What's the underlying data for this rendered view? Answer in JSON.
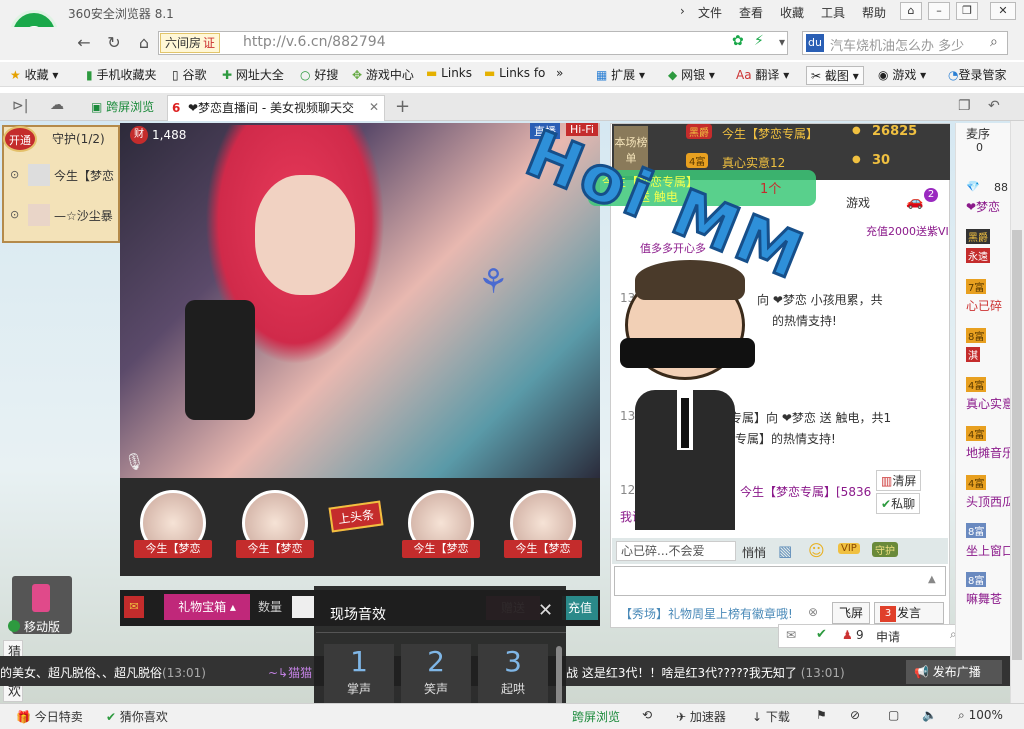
{
  "browser": {
    "title": "360安全浏览器 8.1",
    "menus": [
      "文件",
      "查看",
      "收藏",
      "工具",
      "帮助"
    ],
    "site_badge": "六间房",
    "site_cert": "证",
    "url": "http://v.6.cn/882794",
    "search_placeholder": "汽车烧机油怎么办 多少",
    "favorites": [
      "收藏",
      "手机收藏夹",
      "谷歌",
      "网址大全",
      "好搜",
      "游戏中心",
      "Links",
      "Links fo"
    ],
    "extensions": [
      "扩展",
      "网银",
      "翻译",
      "截图",
      "游戏",
      "登录管家"
    ],
    "tab_cross": "跨屏浏览",
    "tab_active": "❤梦恋直播间 - 美女视频聊天交",
    "status": {
      "today_deals": "今日特卖",
      "guess_like": "猜你喜欢",
      "cross": "跨屏浏览",
      "accel": "加速器",
      "download": "下载",
      "zoom": "100%"
    }
  },
  "page": {
    "guard": {
      "open_label": "开通",
      "title": "守护(1/2)",
      "members": [
        "今生【梦恋",
        "—☆沙尘暴"
      ]
    },
    "viewer_count": "1,488",
    "live_badge": "直播",
    "hifi_badge": "Hi-Fi",
    "hearts_label": "今生【梦恋",
    "headline_badge": "上头条",
    "gift_box_label": "礼物宝箱",
    "quantity_label": "数量",
    "gift_target": "梦恋",
    "give_button": "赠送",
    "recharge_button": "充值",
    "mobile_label": "移动版",
    "guess_label": "猜你喜欢",
    "rank": {
      "this_show": "本场榜单",
      "rows": [
        {
          "name": "今生【梦恋专属】",
          "badge": "黑爵",
          "coins": "26825"
        },
        {
          "name": "真心实意12",
          "badge": "4富",
          "coins": "30"
        }
      ]
    },
    "gift_announce": {
      "user": "今生【梦恋专属】",
      "gift": "送 触电",
      "count": "1个"
    },
    "chat": {
      "tab_game": "游戏",
      "tab_count": "2",
      "promo": "充值2000送紫VI",
      "promo2": "值多多开心多",
      "messages": [
        {
          "time": "13",
          "text": "向 ❤梦恋  小孩甩累，共"
        },
        {
          "time": "",
          "text": "的热情支持!"
        },
        {
          "time": "13:02",
          "text": "专属】向 ❤梦恋 送 触电，共1"
        },
        {
          "time": "",
          "text": "专属】的热情支持!"
        },
        {
          "time": "12:54",
          "text": "今生【梦恋专属】[5836"
        },
        {
          "time": "",
          "text": "我说: 截图"
        }
      ],
      "input_hint": "心已碎...不会爱",
      "quiet_label": "悄悄",
      "clear_label": "清屏",
      "private_label": "私聊",
      "show_notice": "【秀场】礼物周星上榜有徽章哦!",
      "fly_button": "飞屏",
      "send_button": "发言",
      "send_badge": "3"
    },
    "mic": {
      "title": "麦序",
      "count": "0",
      "apply": "申请",
      "add": "添加",
      "people": "9"
    },
    "right_list": [
      "88",
      "❤梦恋",
      "黑爵",
      "永遠",
      "7富",
      "心已碎",
      "8富",
      "淇",
      "4富",
      "真心实意",
      "4富",
      "地摊音乐",
      "4富",
      "头顶西瓜",
      "8富",
      "坐上窗口",
      "8富",
      "嘛舞苍"
    ],
    "sound": {
      "title": "现场音效",
      "buttons": [
        {
          "num": "1",
          "label": "掌声"
        },
        {
          "num": "2",
          "label": "笑声"
        },
        {
          "num": "3",
          "label": "起哄"
        }
      ]
    },
    "ticker_left": "的美女、超凡脱俗、、超凡脱俗",
    "ticker_left_time": "(13:01)",
    "ticker_mid": "~↳猫猫",
    "ticker_right": "战 这是红3代！！啥是红3代?????我无知了",
    "ticker_right_time": "(13:01)",
    "broadcast": "发布广播",
    "mm_text": "Hoi MM"
  },
  "colors": {
    "accent": "#1aa84a",
    "red": "#c42c2c",
    "chat_name": "#8b1a8b"
  }
}
